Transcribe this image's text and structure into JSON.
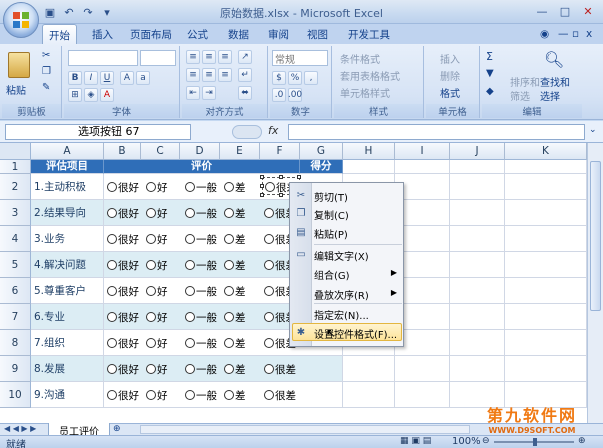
{
  "window": {
    "title": "原始数据.xlsx - Microsoft Excel"
  },
  "ribbon_tabs": [
    "开始",
    "插入",
    "页面布局",
    "公式",
    "数据",
    "审阅",
    "视图",
    "开发工具"
  ],
  "ribbon": {
    "clipboard": {
      "paste": "粘贴",
      "label": "剪贴板"
    },
    "font": {
      "label": "字体"
    },
    "alignment": {
      "label": "对齐方式"
    },
    "number": {
      "format": "常规",
      "label": "数字"
    },
    "styles": {
      "cond": "条件格式",
      "table": "套用表格格式",
      "cell": "单元格样式",
      "label": "样式"
    },
    "cells": {
      "insert": "插入",
      "delete": "删除",
      "format": "格式",
      "label": "单元格"
    },
    "editing": {
      "sort": "排序和",
      "sort2": "筛选",
      "find": "查找和",
      "find2": "选择",
      "label": "编辑"
    }
  },
  "formula_bar": {
    "name_box": "选项按钮 67",
    "fx": "fx",
    "content": ""
  },
  "sheet": {
    "columns": [
      "A",
      "B",
      "C",
      "D",
      "E",
      "F",
      "G",
      "H",
      "I",
      "J",
      "K"
    ],
    "rows": [
      "1",
      "2",
      "3",
      "4",
      "5",
      "6",
      "7",
      "8",
      "9",
      "10"
    ],
    "header": {
      "item": "评估项目",
      "rating": "评价",
      "score": "得分"
    },
    "items": [
      "1.主动积极",
      "2.结果导向",
      "3.业务",
      "4.解决问题",
      "5.尊重客户",
      "6.专业",
      "7.组织",
      "8.发展",
      "9.沟通"
    ],
    "options": [
      "很好",
      "好",
      "一般",
      "差",
      "很差"
    ]
  },
  "context_menu": [
    {
      "label": "剪切(T)",
      "icon": "scissors-icon"
    },
    {
      "label": "复制(C)",
      "icon": "copy-icon"
    },
    {
      "label": "粘贴(P)",
      "icon": "paste-icon"
    },
    {
      "label": "编辑文字(X)",
      "icon": "edit-text-icon"
    },
    {
      "label": "组合(G)",
      "icon": "",
      "submenu": true
    },
    {
      "label": "叠放次序(R)",
      "icon": "",
      "submenu": true
    },
    {
      "label": "指定宏(N)...",
      "icon": ""
    },
    {
      "label": "设置控件格式(F)...",
      "icon": "format-control-icon",
      "highlighted": true
    }
  ],
  "sheet_tabs": {
    "active": "员工评价"
  },
  "status": {
    "mode": "就绪",
    "zoom": "100%"
  },
  "watermark": {
    "line1": "第九软件网",
    "line2": "WWW.D9SOFT.COM"
  },
  "colors": {
    "header_blue": "#2f6eb8",
    "alt_row": "#dcedf4",
    "watermark_orange": "#f07a14"
  }
}
